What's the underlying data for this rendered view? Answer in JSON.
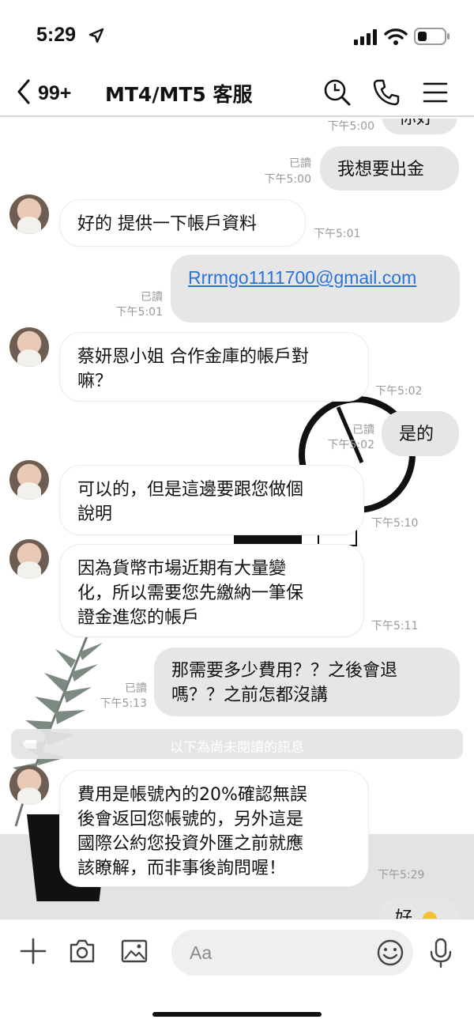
{
  "status": {
    "time": "5:29"
  },
  "header": {
    "back_count": "99+",
    "title": "MT4/MT5 客服"
  },
  "messages": [
    {
      "text": "你好",
      "time": "下午5:00"
    },
    {
      "read": "已讀",
      "time": "下午5:00",
      "text": "我想要出金"
    },
    {
      "text": "好的 提供一下帳戶資料",
      "time": "下午5:01"
    },
    {
      "read": "已讀",
      "time": "下午5:01",
      "text": "Rrrmgo1111700@gmail.com"
    },
    {
      "line1": "蔡妍恩小姐 合作金庫的帳戶對",
      "line2": "嘛？",
      "time": "下午5:02"
    },
    {
      "read": "已讀",
      "time": "下午5:02",
      "text": "是的"
    },
    {
      "line1": "可以的，但是這邊要跟您做個",
      "line2": "說明",
      "time": "下午5:10"
    },
    {
      "line1": "因為貨幣市場近期有大量變",
      "line2": "化，所以需要您先繳納一筆保",
      "line3": "證金進您的帳戶",
      "time": "下午5:11"
    },
    {
      "read": "已讀",
      "time": "下午5:13",
      "line1": "那需要多少費用？？之後會退",
      "line2": "嗎？？之前怎都沒講"
    },
    {
      "line1": "費用是帳號內的20%確認無誤",
      "line2": "後會返回您帳號的，另外這是",
      "line3": "國際公約您投資外匯之前就應",
      "line4": "該瞭解，而非事後詢問喔！",
      "time": "下午5:29"
    },
    {
      "text": "好"
    }
  ],
  "unread_divider": "以下為尚未閱讀的訊息",
  "input": {
    "placeholder": "Aa"
  },
  "colors": {
    "outgoing_bubble": "#e6e6e6",
    "incoming_bubble": "#ffffff",
    "link": "#2a73d9",
    "meta": "#9a9a9a"
  }
}
